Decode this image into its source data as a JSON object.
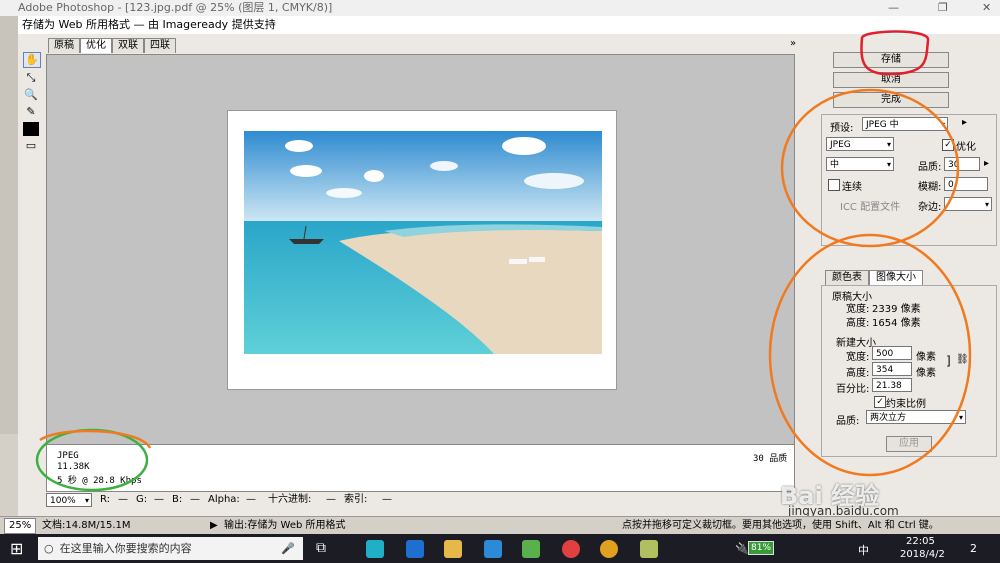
{
  "window": {
    "title": "Adobe Photoshop - [123.jpg.pdf @ 25% (图层 1, CMYK/8)]",
    "controls": [
      "—",
      "❐",
      "✕"
    ]
  },
  "dialog": {
    "title": "存储为 Web 所用格式 — 由 Imageready 提供支持",
    "tabs": [
      "原稿",
      "优化",
      "双联",
      "四联"
    ],
    "active_tab": "优化"
  },
  "info": {
    "format": "JPEG",
    "size": "11.38K",
    "time": "5 秒 @ 28.8 Kbps",
    "quality_label": "30 品质"
  },
  "statusbar": {
    "zoom": "100%",
    "r_label": "R:",
    "r_val": "—",
    "g_label": "G:",
    "g_val": "—",
    "b_label": "B:",
    "b_val": "—",
    "alpha_label": "Alpha:",
    "alpha_val": "—",
    "hex_label": "十六进制:",
    "hex_val": "—",
    "index_label": "索引:",
    "index_val": "—"
  },
  "buttons": {
    "save": "存储",
    "cancel": "取消",
    "done": "完成",
    "apply": "应用"
  },
  "settings": {
    "preset_label": "预设:",
    "preset_value": "JPEG 中",
    "format_value": "JPEG",
    "optimize_label": "优化",
    "quality_level": "中",
    "quality_label": "品质:",
    "quality_value": "30",
    "progressive_label": "连续",
    "blur_label": "模糊:",
    "blur_value": "0",
    "icc_label": "ICC 配置文件",
    "matte_label": "杂边:"
  },
  "size_panel": {
    "tabs": [
      "颜色表",
      "图像大小"
    ],
    "original_header": "原稿大小",
    "orig_width_label": "宽度:",
    "orig_width": "2339 像素",
    "orig_height_label": "高度:",
    "orig_height": "1654 像素",
    "new_header": "新建大小",
    "new_width_label": "宽度:",
    "new_width": "500",
    "new_height_label": "高度:",
    "new_height": "354",
    "unit": "像素",
    "percent_label": "百分比:",
    "percent": "21.38",
    "constrain_label": "约束比例",
    "quality_label": "品质:",
    "quality_value": "两次立方"
  },
  "ps_status": {
    "zoom": "25%",
    "doc": "文档:14.8M/15.1M",
    "output": "输出:存储为 Web 所用格式",
    "hint": "点按并拖移可定义裁切框。要用其他选项，使用 Shift、Alt 和 Ctrl 键。"
  },
  "taskbar": {
    "search_placeholder": "在这里输入你要搜索的内容",
    "battery": "81%",
    "ime": "中",
    "time": "22:05",
    "date": "2018/4/2",
    "notifications": "2"
  },
  "watermark": {
    "brand": "Bai 经验",
    "url": "jingyan.baidu.com"
  },
  "annotation_colors": {
    "red": "#e0202a",
    "orange": "#f07a20",
    "green": "#3cb040"
  }
}
